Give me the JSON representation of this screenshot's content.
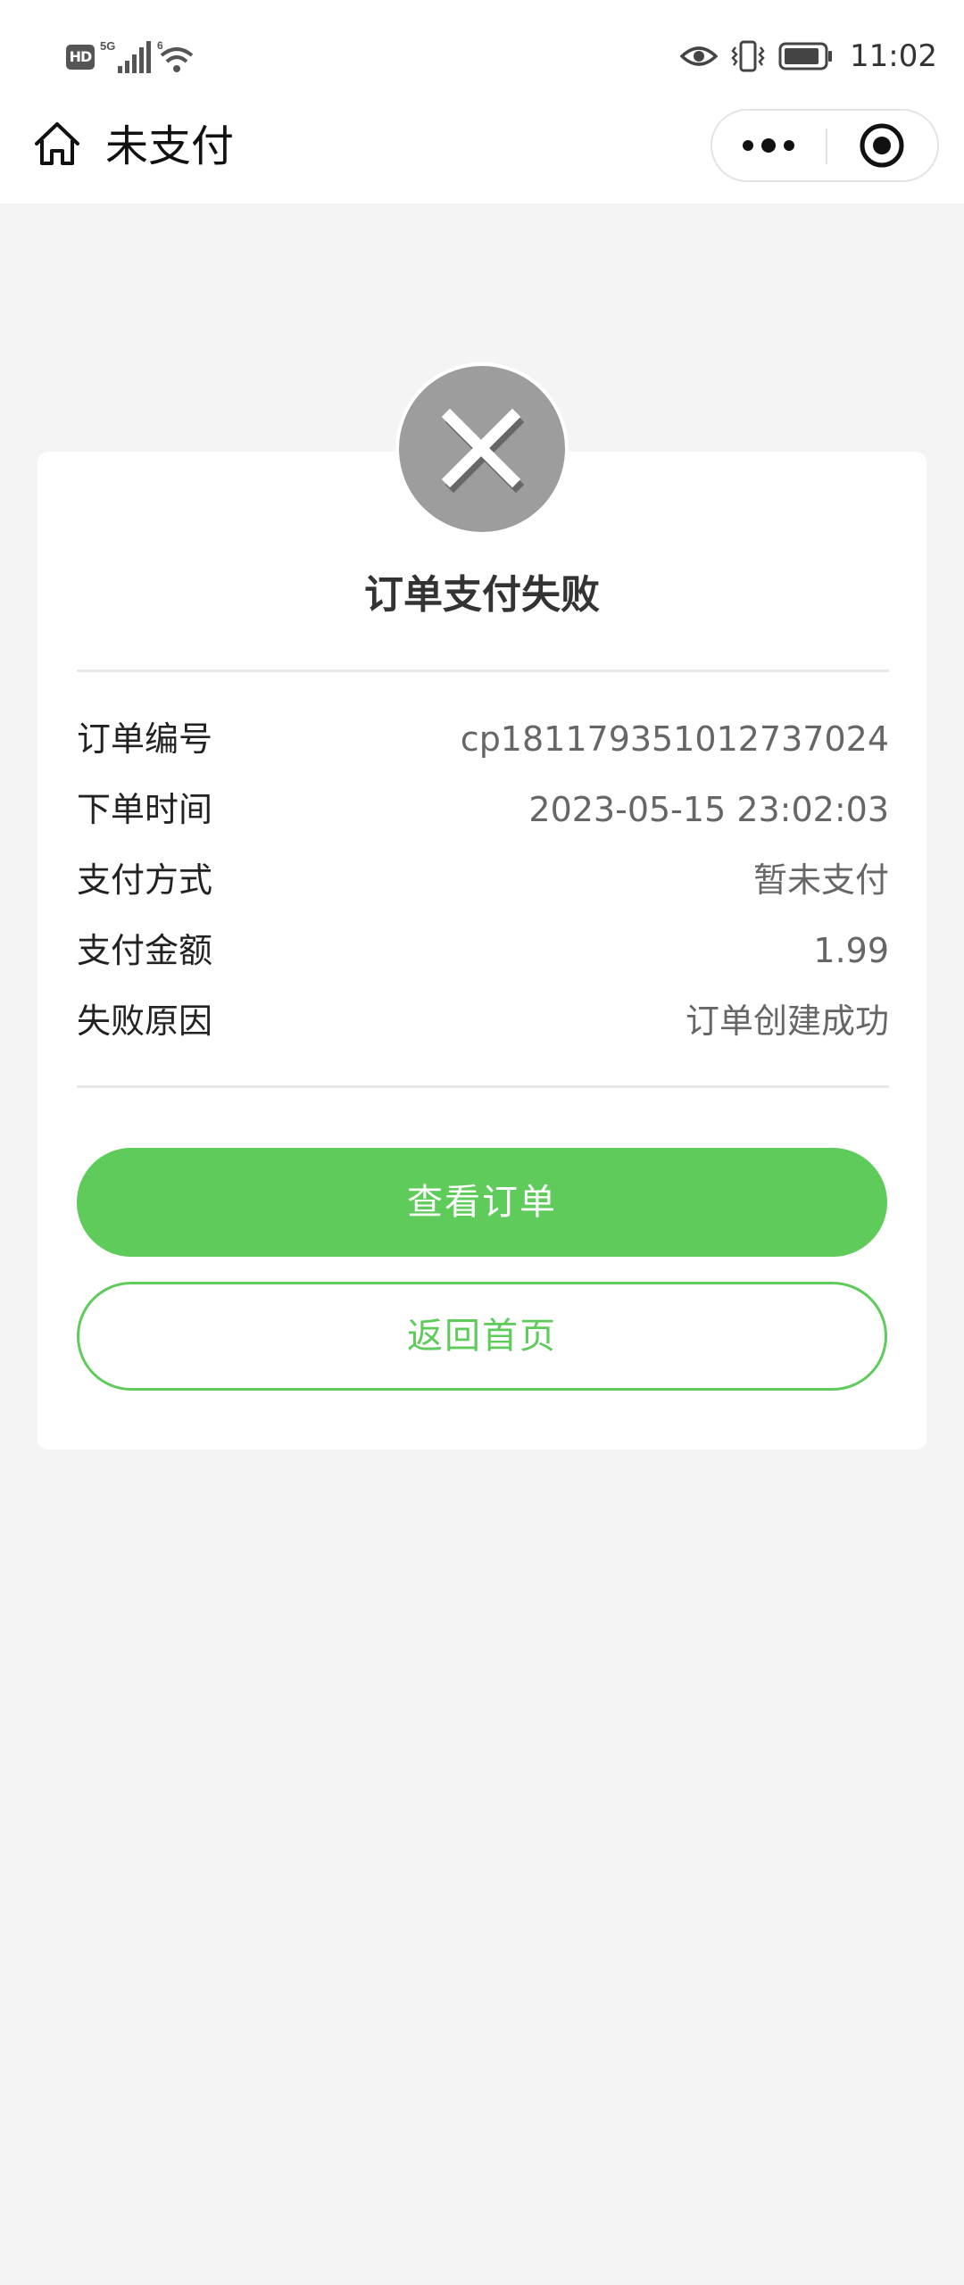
{
  "status_bar": {
    "network_badge": "HD",
    "network_type": "5G",
    "wifi_label": "6",
    "time": "11:02",
    "icons": [
      "eye-icon",
      "vibrate-icon",
      "battery-icon"
    ]
  },
  "nav": {
    "title": "未支付",
    "home_icon": "home-icon",
    "more_icon": "more-dots-icon",
    "close_icon": "target-close-icon"
  },
  "result": {
    "icon": "close-x-icon",
    "title": "订单支付失败",
    "status_color": "#9d9d9d"
  },
  "order_info": [
    {
      "label": "订单编号",
      "value": "cp181179351012737024"
    },
    {
      "label": "下单时间",
      "value": "2023-05-15 23:02:03"
    },
    {
      "label": "支付方式",
      "value": "暂未支付"
    },
    {
      "label": "支付金额",
      "value": "1.99"
    },
    {
      "label": "失败原因",
      "value": "订单创建成功"
    }
  ],
  "actions": {
    "view_order_label": "查看订单",
    "back_home_label": "返回首页",
    "accent_color": "#5fcb5b"
  }
}
